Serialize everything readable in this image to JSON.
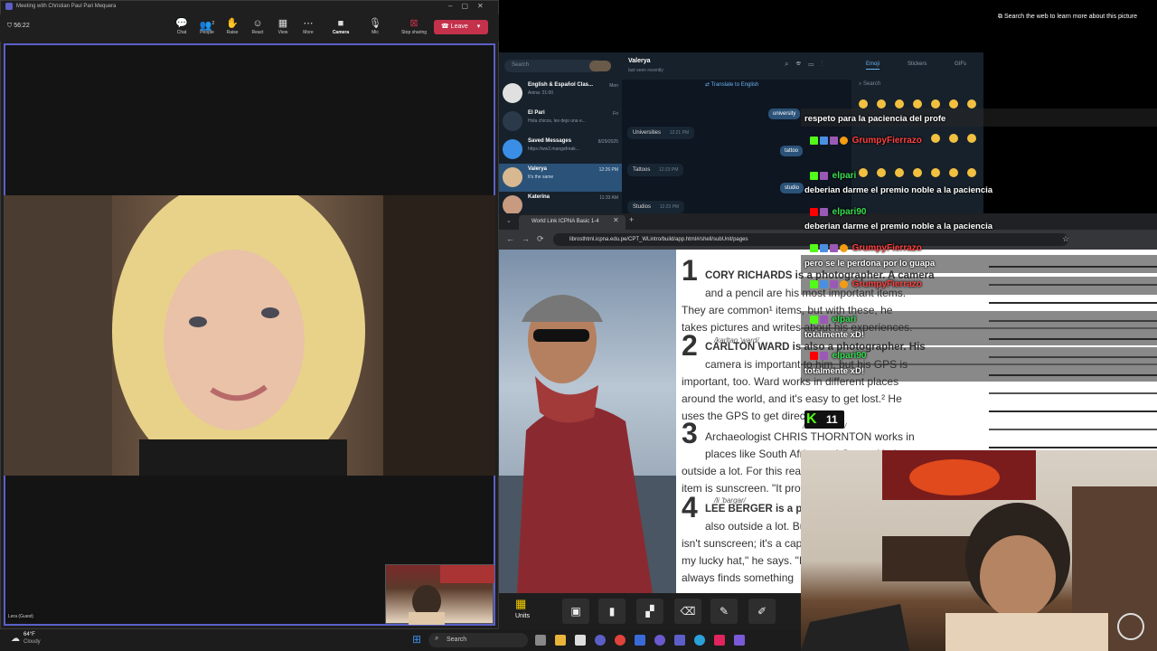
{
  "teams": {
    "title": "Meeting with Christian Paul Pari Mequera",
    "timer": "56:22",
    "toolbar": [
      {
        "label": "Chat",
        "icon": "chat-icon"
      },
      {
        "label": "People",
        "icon": "people-icon"
      },
      {
        "label": "Raise",
        "icon": "raise-hand-icon"
      },
      {
        "label": "React",
        "icon": "react-icon"
      },
      {
        "label": "View",
        "icon": "view-icon"
      },
      {
        "label": "More",
        "icon": "more-icon"
      },
      {
        "label": "Camera",
        "icon": "camera-icon"
      },
      {
        "label": "Mic",
        "icon": "mic-icon"
      },
      {
        "label": "Stop sharing",
        "icon": "stop-sharing-icon"
      }
    ],
    "people_count": "2",
    "leave_label": "Leave",
    "guest_label": "Lera (Guest)"
  },
  "telegram": {
    "search_placeholder": "Search",
    "chats": [
      {
        "name": "English & Español Clas...",
        "preview": "Anina: 21:00",
        "time": "Mon"
      },
      {
        "name": "El Pari",
        "preview": "Hola chicos, les dejo una e...",
        "time": "Fri"
      },
      {
        "name": "Saved Messages",
        "preview": "https://ww2.mangafreak...",
        "time": "8/29/2025"
      },
      {
        "name": "Valerya",
        "preview": "It's the same",
        "time": "12:26 PM"
      },
      {
        "name": "Katerina",
        "preview": "",
        "time": "11:33 AM"
      }
    ],
    "conv_name": "Valerya",
    "conv_status": "last seen recently",
    "translate_label": "Translate to English",
    "messages": [
      {
        "text": "Universities",
        "time": "12:21 PM"
      },
      {
        "text": "Tattoos",
        "time": "12:23 PM"
      },
      {
        "text": "Studios",
        "time": "12:23 PM"
      }
    ],
    "out_messages": [
      "university",
      "tattoo",
      "studio"
    ],
    "emoji_tabs": [
      "Emoji",
      "Stickers",
      "GIFs"
    ],
    "emoji_search_placeholder": "Search"
  },
  "browser": {
    "tab_title": "World Link ICPNA Basic 1-4",
    "url": "librosthtml.icpna.edu.pe/CPT_WLintro/build/app.html#/shell/subUnit/pages",
    "bottom_label": "Units"
  },
  "article": {
    "items": [
      {
        "num": "1",
        "lines": [
          "CORY RICHARDS is a photographer. A camera",
          "and a pencil are his most important items.",
          "They are common¹ items, but with these, he",
          "takes pictures and writes about his experiences."
        ]
      },
      {
        "num": "2",
        "lines": [
          "CARLTON WARD is also a photographer. His",
          "camera is important to him, but his GPS is",
          "important, too. Ward works in different places",
          "around the world, and it's easy to get lost.² He",
          "uses the GPS to get directions."
        ]
      },
      {
        "num": "3",
        "lines": [
          "Archaeologist CHRIS THORNTON works in",
          "places like South Africa and Oman. He is",
          "outside a lot. For this reason, his important",
          "item is sunscreen. \"It protects me,\" he says."
        ]
      },
      {
        "num": "4",
        "lines": [
          "LEE BERGER is a paleoanthropologist. He is",
          "also outside a lot. But his important item",
          "isn't sunscreen; it's a cap. \"It's",
          "my lucky hat,\" he says. \"I",
          "always finds something"
        ]
      }
    ],
    "phonetics": [
      "/karltan 'ward/",
      "/krɪs 'θɔrntən/",
      "/li 'bargar/"
    ]
  },
  "chat_overlay": [
    {
      "user": "",
      "message": "respeto para la paciencia del profe"
    },
    {
      "user": "GrumpyFierrazo",
      "message": ""
    },
    {
      "user": "elpari",
      "message": "deberian darme el premio noble a la paciencia"
    },
    {
      "user": "elpari90",
      "message": "deberian darme el premio noble a la paciencia"
    },
    {
      "user": "GrumpyFierrazo",
      "message": "pero se le perdona por lo guapa"
    },
    {
      "user": "GrumpyFierrazo",
      "message": ""
    },
    {
      "user": "elpari",
      "message": "totalmente xD!"
    },
    {
      "user": "elpari90",
      "message": "totalmente xD!"
    }
  ],
  "viewer_count": "11",
  "search_web_label": "Search the web to learn more about this picture",
  "taskbar": {
    "weather_temp": "64°F",
    "weather_desc": "Cloudy",
    "search_label": "Search"
  },
  "colors": {
    "teams_accent": "#5b5fc7",
    "leave_red": "#c4314b",
    "telegram_bg": "#17212b",
    "grumpy_color": "#ff4040",
    "elpari_color": "#3adf52",
    "kick_green": "#53fc18"
  }
}
